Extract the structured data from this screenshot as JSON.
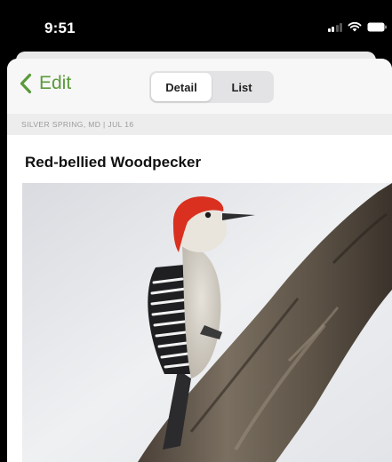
{
  "status_bar": {
    "time": "9:51",
    "icons": [
      "signal-icon",
      "wifi-icon",
      "battery-icon"
    ]
  },
  "nav": {
    "back_label": "Edit",
    "segments": [
      {
        "label": "Detail",
        "selected": true
      },
      {
        "label": "List",
        "selected": false
      }
    ]
  },
  "observation": {
    "location_date": "SILVER SPRING, MD  |  JUL 16",
    "species": "Red-bellied Woodpecker"
  },
  "colors": {
    "accent": "#5a9a3a",
    "status_bar": "#000000",
    "sheet": "#ffffff"
  }
}
